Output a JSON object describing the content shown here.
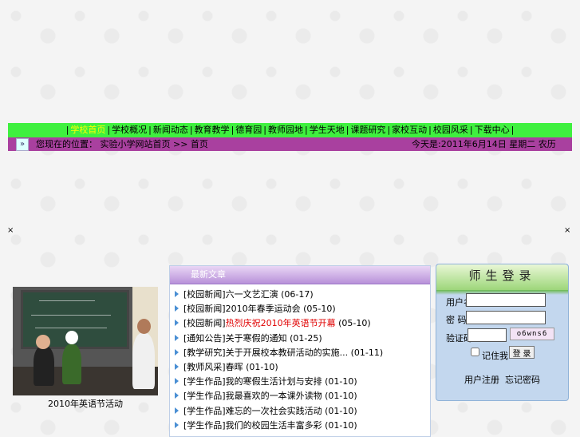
{
  "nav": {
    "items": [
      {
        "label": "学校首页",
        "active": true
      },
      {
        "label": "学校概况",
        "active": false
      },
      {
        "label": "新闻动态",
        "active": false
      },
      {
        "label": "教育教学",
        "active": false
      },
      {
        "label": "德育园",
        "active": false
      },
      {
        "label": "教师园地",
        "active": false
      },
      {
        "label": "学生天地",
        "active": false
      },
      {
        "label": "课题研究",
        "active": false
      },
      {
        "label": "家校互动",
        "active": false
      },
      {
        "label": "校园风采",
        "active": false
      },
      {
        "label": "下载中心",
        "active": false
      }
    ]
  },
  "subbar": {
    "breadcrumb": "您现在的位置： 实验小学网站首页 >> 首页",
    "date": "今天是:2011年6月14日 星期二 农历"
  },
  "photo": {
    "caption": "2010年英语节活动"
  },
  "news": {
    "header": "最新文章",
    "items": [
      {
        "tag": "[校园新闻]",
        "title": "六一文艺汇演",
        "red": false,
        "date": "(06-17)"
      },
      {
        "tag": "[校园新闻]",
        "title": "2010年春季运动会",
        "red": false,
        "date": "(05-10)"
      },
      {
        "tag": "[校园新闻]",
        "title": "热烈庆祝2010年英语节开幕",
        "red": true,
        "date": "(05-10)"
      },
      {
        "tag": "[通知公告]",
        "title": "关于寒假的通知",
        "red": false,
        "date": "(01-25)"
      },
      {
        "tag": "[教学研究]",
        "title": "关于开展校本教研活动的实施...",
        "red": false,
        "date": "(01-11)"
      },
      {
        "tag": "[教师风采]",
        "title": "春晖",
        "red": false,
        "date": "(01-10)"
      },
      {
        "tag": "[学生作品]",
        "title": "我的寒假生活计划与安排",
        "red": false,
        "date": "(01-10)"
      },
      {
        "tag": "[学生作品]",
        "title": "我最喜欢的一本课外读物",
        "red": false,
        "date": "(01-10)"
      },
      {
        "tag": "[学生作品]",
        "title": "难忘的一次社会实践活动",
        "red": false,
        "date": "(01-10)"
      },
      {
        "tag": "[学生作品]",
        "title": "我们的校园生活丰富多彩",
        "red": false,
        "date": "(01-10)"
      }
    ]
  },
  "login": {
    "title": "师生登录",
    "username_label": "用户名：",
    "password_label": "密 码：",
    "captcha_label": "验证码：",
    "captcha_text": "o6wns6",
    "remember_label": "记住我",
    "submit_label": "登 录",
    "register_label": "用户注册",
    "forgot_label": "忘记密码"
  },
  "icons": {
    "nav_arrow": "double-chevron-right-icon"
  }
}
